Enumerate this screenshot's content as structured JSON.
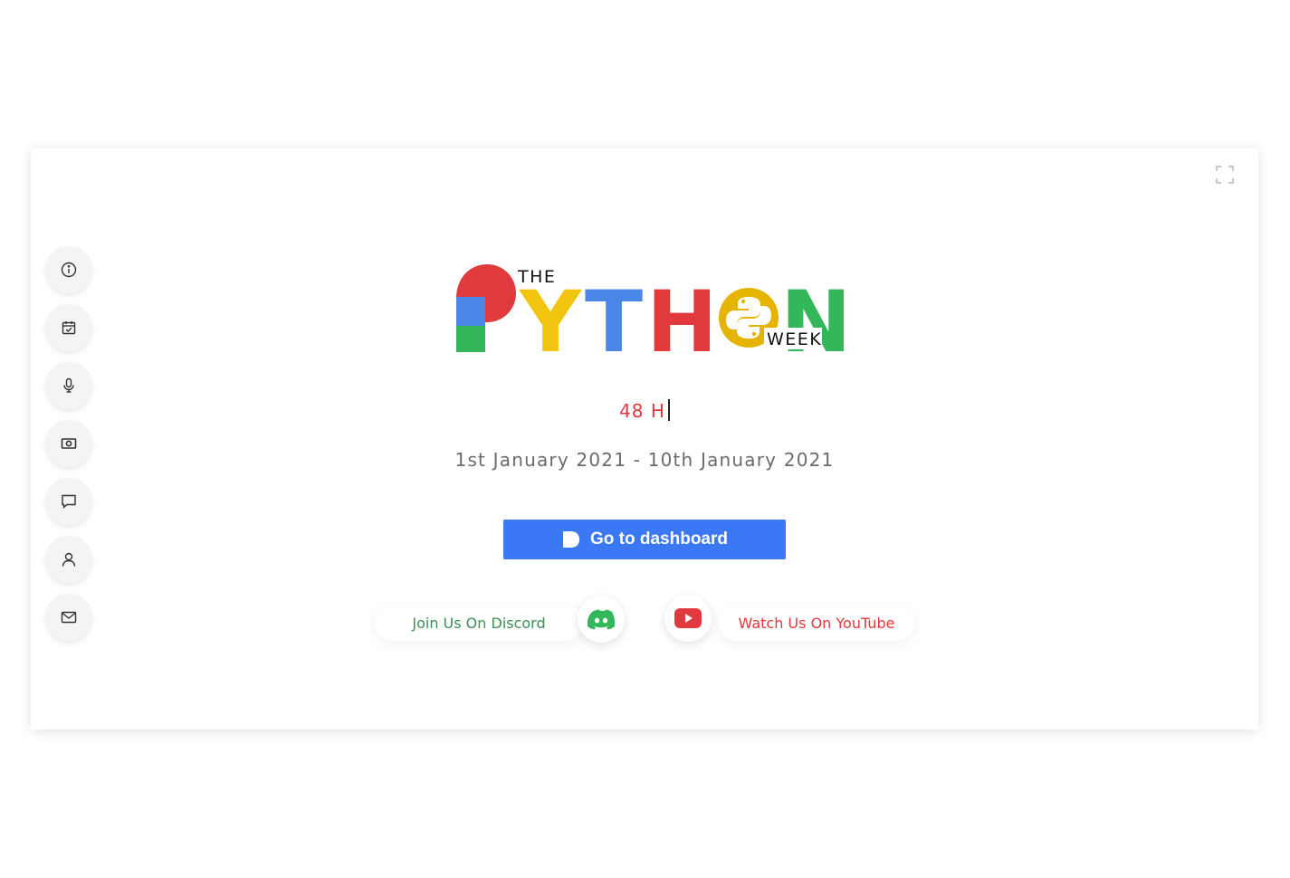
{
  "logo": {
    "the": "THE",
    "week": "WEEK",
    "letters": [
      "Y",
      "T",
      "H",
      "N"
    ],
    "colors": {
      "red": "#e0393e",
      "blue": "#4a86e8",
      "green": "#34b65a",
      "yellow": "#f1c40f",
      "gold": "#e4b400"
    }
  },
  "hero": {
    "typing_text": "48 H",
    "dates": "1st January 2021 - 10th January 2021"
  },
  "dashboard_button": {
    "label": "Go to dashboard",
    "color": "#3b78f5"
  },
  "social": {
    "discord_label": "Join Us On Discord",
    "youtube_label": "Watch Us On YouTube",
    "discord_color": "#3d8f55",
    "youtube_color": "#e0393e"
  },
  "sidebar": {
    "items": [
      {
        "icon": "info-icon"
      },
      {
        "icon": "calendar-check-icon"
      },
      {
        "icon": "microphone-icon"
      },
      {
        "icon": "camera-icon"
      },
      {
        "icon": "chat-icon"
      },
      {
        "icon": "user-icon"
      },
      {
        "icon": "mail-icon"
      }
    ]
  },
  "toolbar": {
    "fullscreen_icon": "fullscreen-icon"
  }
}
